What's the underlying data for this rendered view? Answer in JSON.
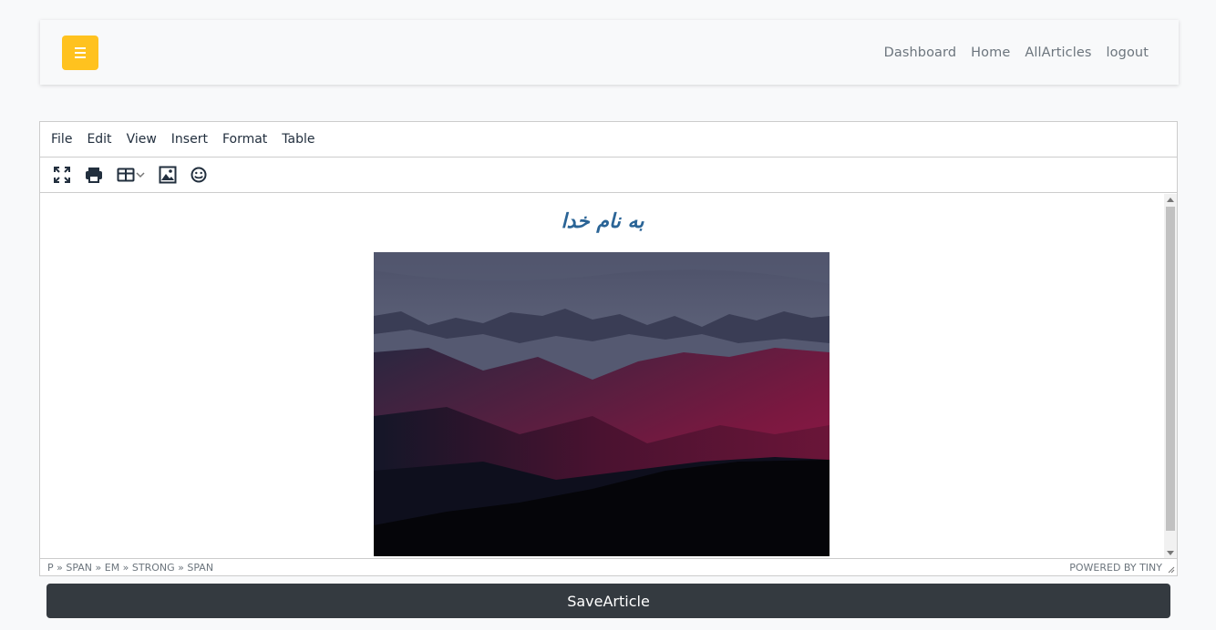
{
  "navbar": {
    "menu_icon": "hamburger-icon",
    "links": [
      "Dashboard",
      "Home",
      "AllArticles",
      "logout"
    ],
    "accent": "#ffc21f"
  },
  "editor": {
    "menubar": [
      "File",
      "Edit",
      "View",
      "Insert",
      "Format",
      "Table"
    ],
    "toolbar_icons": [
      "fullscreen-icon",
      "print-icon",
      "table-icon",
      "image-icon",
      "emoticon-icon"
    ],
    "content": {
      "heading": "به نام خدا",
      "heading_color": "#2a6496"
    },
    "statusbar": {
      "path": "P » SPAN » EM » STRONG » SPAN",
      "powered_by": "POWERED BY TINY"
    }
  },
  "save_button": {
    "label": "SaveArticle",
    "color": "#343a40"
  }
}
